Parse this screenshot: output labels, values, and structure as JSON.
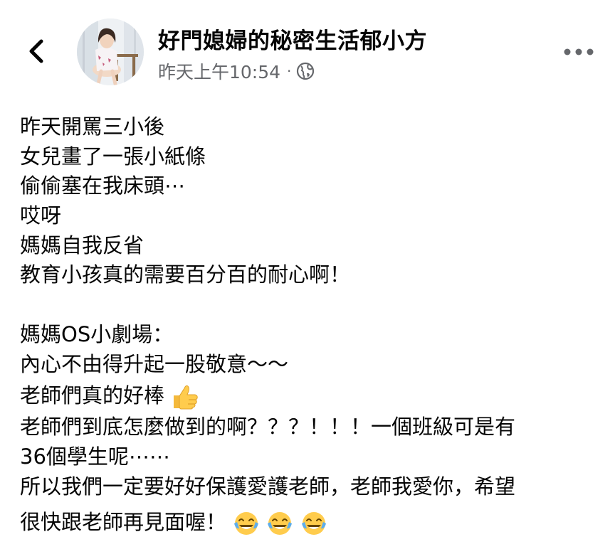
{
  "header": {
    "author_name": "好門媳婦的秘密生活郁小方",
    "timestamp": "昨天上午10:54",
    "separator": "·",
    "audience_icon": "globe-icon",
    "back_icon": "chevron-left-icon",
    "more_icon": "more-horizontal-icon"
  },
  "post": {
    "lines": [
      "昨天開罵三小後",
      "女兒畫了一張小紙條",
      "偷偷塞在我床頭⋯",
      "哎呀",
      "媽媽自我反省",
      "教育小孩真的需要百分百的耐心啊！",
      "",
      "媽媽OS小劇場：",
      "內心不由得升起一股敬意～～",
      "老師們真的好棒",
      "老師們到底怎麼做到的啊？？？！！！一個班級可是有",
      "36個學生呢⋯⋯",
      "所以我們一定要好好保護愛護老師，老師我愛你，希望",
      "很快跟老師再見面喔！"
    ],
    "emojis": {
      "thumbs_up": "thumbs-up-emoji",
      "laughing": "face-with-tears-of-joy-emoji"
    }
  }
}
